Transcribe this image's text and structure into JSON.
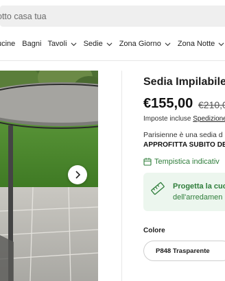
{
  "search": {
    "placeholder": "otto casa tua"
  },
  "nav": {
    "items": [
      {
        "label": "ucine",
        "has_dropdown": false
      },
      {
        "label": "Bagni",
        "has_dropdown": false
      },
      {
        "label": "Tavoli",
        "has_dropdown": true
      },
      {
        "label": "Sedie",
        "has_dropdown": true
      },
      {
        "label": "Zona Giorno",
        "has_dropdown": true
      },
      {
        "label": "Zona Notte",
        "has_dropdown": true
      }
    ]
  },
  "gallery": {
    "next_icon": "chevron-right-icon"
  },
  "product": {
    "title": "Sedia Impilabile",
    "price": "€155,00",
    "old_price": "€210,0",
    "tax_prefix": "Imposte incluse",
    "tax_link": "Spedizione",
    "description": "Parisienne è una sedia d",
    "promo": "APPROFITTA SUBITO DEL",
    "delivery": "Tempistica indicativ",
    "delivery_icon": "calendar-icon",
    "accent_color": "#2e7d3a"
  },
  "design_card": {
    "icon": "ruler-icon",
    "title": "Progetta la cuc",
    "subtitle": "dell'arredamen",
    "background": "#ecf6ee"
  },
  "options": {
    "color_label": "Colore",
    "color_value": "P848 Trasparente"
  }
}
